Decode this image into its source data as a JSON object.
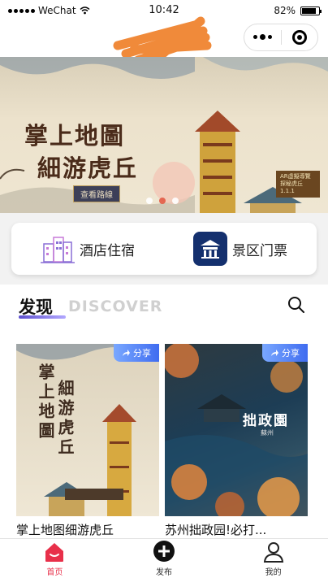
{
  "status_bar": {
    "carrier": "WeChat",
    "time": "10:42",
    "battery": "82%"
  },
  "banner": {
    "title_line1": "掌上地圖",
    "title_line2": "細游虎丘",
    "tag": "查看路線",
    "seal": "AR虛擬導覽 探秘虎丘 1.1.1",
    "active_page": 1,
    "page_count": 3
  },
  "quick_entries": [
    {
      "label": "酒店住宿",
      "icon": "hotel-building-icon"
    },
    {
      "label": "景区门票",
      "icon": "temple-ticket-icon"
    }
  ],
  "discover": {
    "title": "发现",
    "subtitle": "DISCOVER"
  },
  "cards": [
    {
      "title": "掌上地图细游虎丘",
      "share_label": "分享",
      "art_line1": "掌上地圖",
      "art_line2": "細游虎丘"
    },
    {
      "title": "苏州拙政园!必打...",
      "share_label": "分享",
      "art_title": "拙政園",
      "art_sub": "蘇州"
    }
  ],
  "tabbar": [
    {
      "label": "首页",
      "icon": "home-icon",
      "active": true
    },
    {
      "label": "发布",
      "icon": "plus-circle-icon",
      "active": false
    },
    {
      "label": "我的",
      "icon": "user-icon",
      "active": false
    }
  ],
  "colors": {
    "accent": "#e8304a",
    "discover_underline": "#5d4fcf",
    "share_button": "#3f6cf0",
    "ticket_icon_bg": "#14306e"
  }
}
